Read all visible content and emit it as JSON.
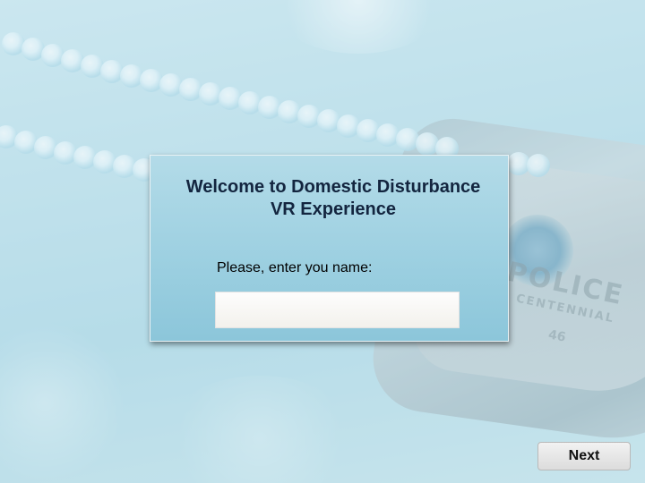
{
  "dialog": {
    "title_line1": "Welcome to Domestic Disturbance",
    "title_line2": "VR Experience",
    "name_label": "Please, enter you name:",
    "name_input_value": "",
    "name_input_placeholder": ""
  },
  "footer": {
    "next_label": "Next"
  },
  "background": {
    "badge_word": "POLICE",
    "badge_subtext": "CENTENNIAL",
    "badge_number": "46"
  },
  "colors": {
    "dialog_top": "#b3dbe8",
    "dialog_bottom": "#8cc6da",
    "title_text": "#13253f",
    "background": "#b7dde9"
  }
}
